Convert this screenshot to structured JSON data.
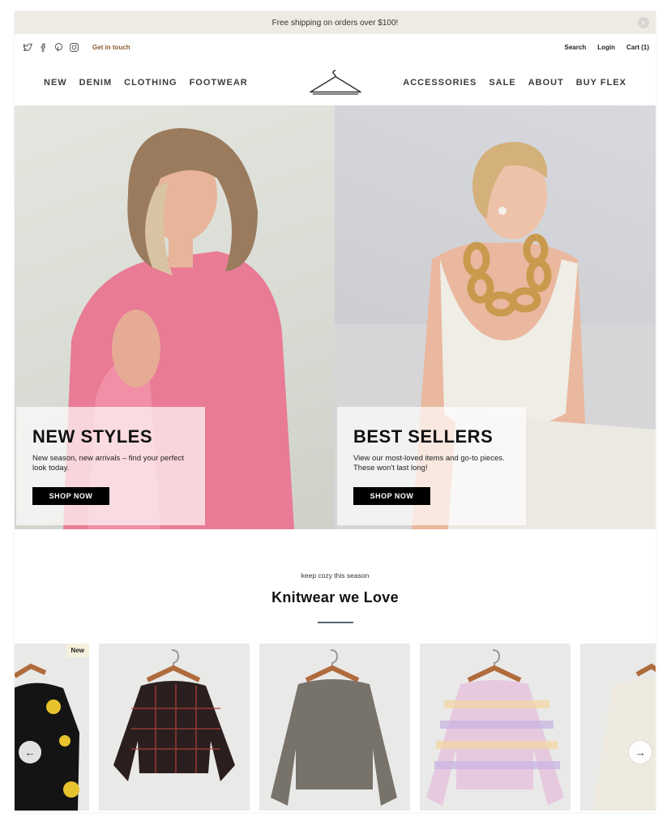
{
  "announcement": {
    "text": "Free shipping on orders over $100!",
    "close_icon": "×"
  },
  "utility": {
    "social_icons": [
      "twitter-icon",
      "facebook-icon",
      "pinterest-icon",
      "instagram-icon"
    ],
    "get_in_touch": "Get in touch",
    "search": "Search",
    "login": "Login",
    "cart": "Cart (1)"
  },
  "nav": {
    "left": [
      "NEW",
      "DENIM",
      "CLOTHING",
      "FOOTWEAR"
    ],
    "right": [
      "ACCESSORIES",
      "SALE",
      "ABOUT",
      "BUY FLEX"
    ],
    "logo_icon": "hanger-logo-icon"
  },
  "hero": {
    "left": {
      "title": "NEW STYLES",
      "text": "New season, new arrivals – find your perfect look today.",
      "button": "SHOP NOW"
    },
    "right": {
      "title": "BEST SELLERS",
      "text": "View our most-loved items and go-to pieces. These won't last long!",
      "button": "SHOP NOW"
    }
  },
  "section": {
    "eyebrow": "keep cozy this season",
    "title": "Knitwear we Love"
  },
  "carousel": {
    "badge": "New",
    "prev_icon": "arrow-left-icon",
    "next_icon": "arrow-right-icon",
    "prev_glyph": "←",
    "next_glyph": "→"
  },
  "colors": {
    "announcement_bg": "#eeebe4",
    "accent_link": "#8a5a2b",
    "button_bg": "#000000",
    "rule": "#5a6673"
  }
}
